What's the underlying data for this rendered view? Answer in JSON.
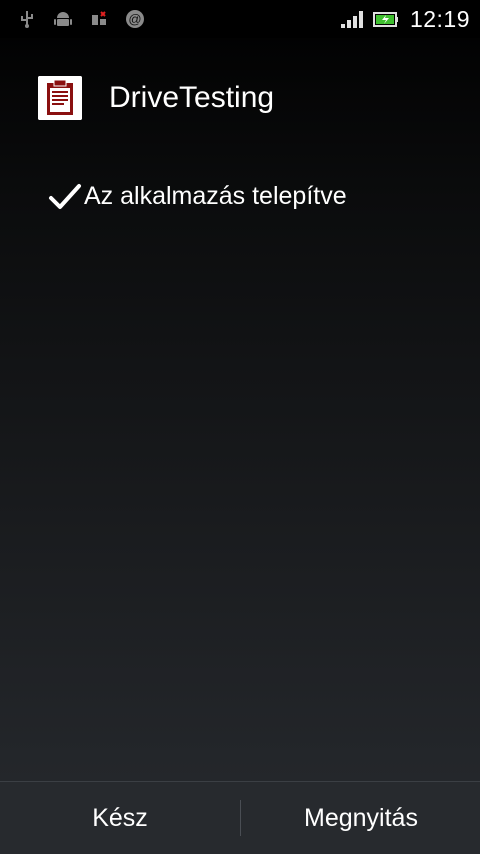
{
  "status_bar": {
    "time": "12:19",
    "icons": [
      "usb-icon",
      "android-debug-icon",
      "sim-icon",
      "at-icon",
      "signal-icon",
      "battery-icon"
    ]
  },
  "app": {
    "title": "DriveTesting",
    "icon": "clipboard-icon"
  },
  "message": {
    "text": "Az alkalmazás telepítve",
    "icon": "checkmark-icon"
  },
  "buttons": {
    "done_label": "Kész",
    "open_label": "Megnyitás"
  },
  "colors": {
    "app_icon_red": "#8a1010",
    "battery_green": "#3fbf2f"
  }
}
